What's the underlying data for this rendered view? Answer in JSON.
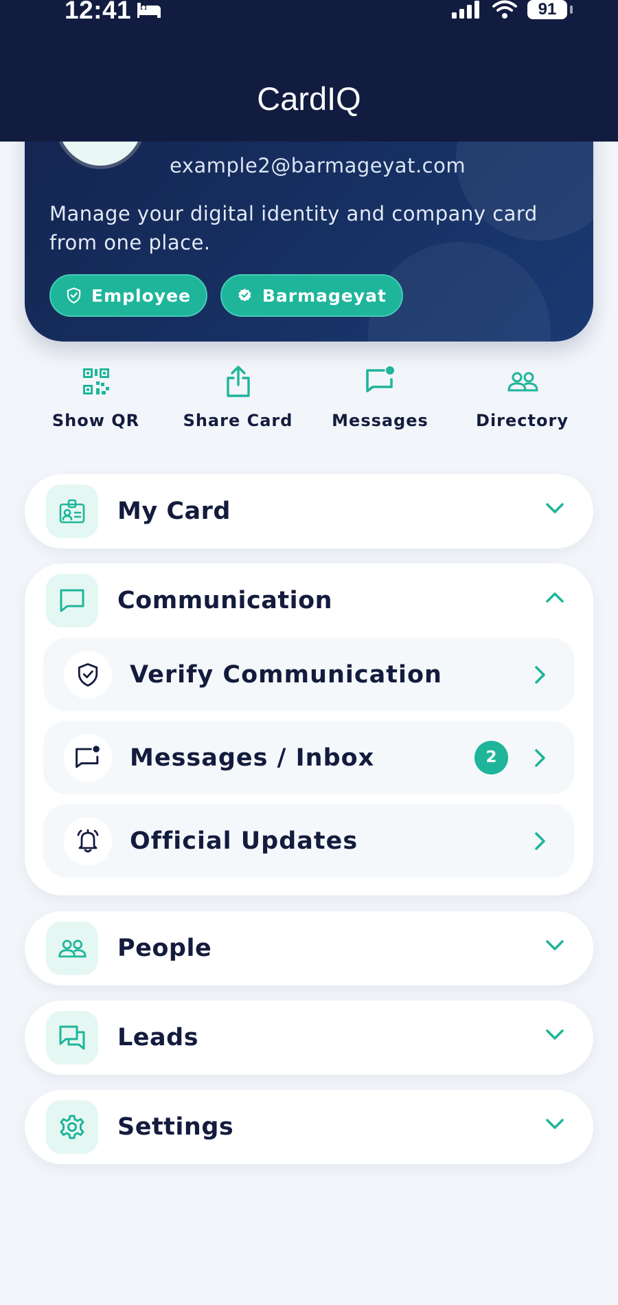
{
  "status_bar": {
    "time": "12:41",
    "battery": "91"
  },
  "header": {
    "title": "CardIQ"
  },
  "profile": {
    "email": "example2@barmageyat.com",
    "description": "Manage your digital identity and company card from one place.",
    "badges": [
      "Employee",
      "Barmageyat"
    ]
  },
  "quick_actions": [
    {
      "label": "Show QR",
      "icon": "qr-code-icon"
    },
    {
      "label": "Share Card",
      "icon": "share-icon"
    },
    {
      "label": "Messages",
      "icon": "message-notification-icon"
    },
    {
      "label": "Directory",
      "icon": "people-icon"
    }
  ],
  "sections": {
    "my_card": {
      "title": "My Card",
      "icon": "id-card-icon",
      "expanded": false
    },
    "communication": {
      "title": "Communication",
      "icon": "chat-icon",
      "expanded": true,
      "items": [
        {
          "label": "Verify Communication",
          "icon": "shield-check-icon"
        },
        {
          "label": "Messages / Inbox",
          "icon": "message-notification-icon",
          "badge": "2"
        },
        {
          "label": "Official Updates",
          "icon": "bell-icon"
        }
      ]
    },
    "people": {
      "title": "People",
      "icon": "people-icon",
      "expanded": false
    },
    "leads": {
      "title": "Leads",
      "icon": "chat-bubbles-icon",
      "expanded": false
    },
    "settings": {
      "title": "Settings",
      "icon": "gear-icon",
      "expanded": false
    }
  },
  "colors": {
    "navy": "#121c40",
    "accent": "#1eb59b",
    "background": "#f2f5f9"
  }
}
